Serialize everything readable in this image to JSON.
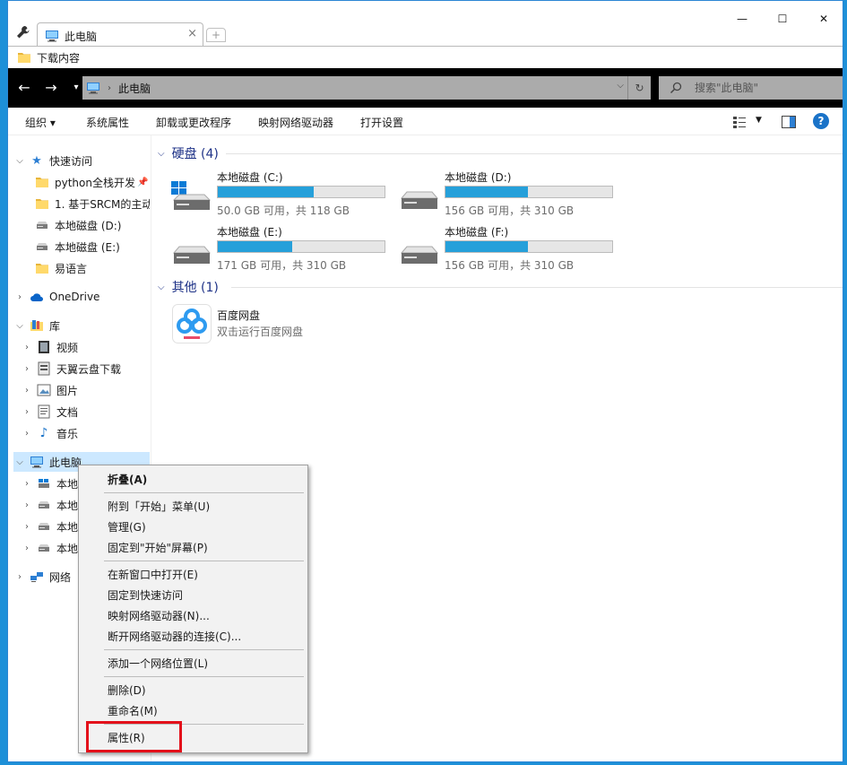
{
  "window": {
    "tab_title": "此电脑",
    "tab_close": "×",
    "new_tab": "+",
    "minimize": "—",
    "maximize": "☐",
    "close": "✕"
  },
  "bookmarks": [
    {
      "label": "下载内容"
    }
  ],
  "address": {
    "path": "此电脑",
    "search_placeholder": "搜索\"此电脑\""
  },
  "toolbar": {
    "organize": "组织",
    "organize_caret": "▾",
    "system_properties": "系统属性",
    "uninstall": "卸载或更改程序",
    "map_drive": "映射网络驱动器",
    "open_settings": "打开设置",
    "help": "?"
  },
  "sidebar": {
    "quick_access": "快速访问",
    "quick_items": [
      {
        "label": "python全栈开发"
      },
      {
        "label": "1. 基于SRCM的主动"
      },
      {
        "label": "本地磁盘 (D:)"
      },
      {
        "label": "本地磁盘 (E:)"
      },
      {
        "label": "易语言"
      }
    ],
    "onedrive": "OneDrive",
    "library": "库",
    "library_items": [
      {
        "label": "视频"
      },
      {
        "label": "天翼云盘下载"
      },
      {
        "label": "图片"
      },
      {
        "label": "文档"
      },
      {
        "label": "音乐"
      }
    ],
    "this_pc": "此电脑",
    "pc_items": [
      {
        "label": "本地"
      },
      {
        "label": "本地"
      },
      {
        "label": "本地"
      },
      {
        "label": "本地"
      }
    ],
    "network": "网络"
  },
  "content": {
    "drives_header": "硬盘 (4)",
    "drives": [
      {
        "name": "本地磁盘 (C:)",
        "info": "50.0 GB 可用，共 118 GB",
        "used_fraction": 0.576
      },
      {
        "name": "本地磁盘 (D:)",
        "info": "156 GB 可用，共 310 GB",
        "used_fraction": 0.497
      },
      {
        "name": "本地磁盘 (E:)",
        "info": "171 GB 可用，共 310 GB",
        "used_fraction": 0.448
      },
      {
        "name": "本地磁盘 (F:)",
        "info": "156 GB 可用，共 310 GB",
        "used_fraction": 0.497
      }
    ],
    "other_header": "其他 (1)",
    "apps": [
      {
        "name": "百度网盘",
        "desc": "双击运行百度网盘"
      }
    ]
  },
  "context_menu": {
    "items": [
      {
        "label": "折叠(A)"
      },
      {
        "label": "附到「开始」菜单(U)"
      },
      {
        "label": "管理(G)"
      },
      {
        "label": "固定到\"开始\"屏幕(P)"
      },
      {
        "label": "在新窗口中打开(E)"
      },
      {
        "label": "固定到快速访问"
      },
      {
        "label": "映射网络驱动器(N)..."
      },
      {
        "label": "断开网络驱动器的连接(C)..."
      },
      {
        "label": "添加一个网络位置(L)"
      },
      {
        "label": "删除(D)"
      },
      {
        "label": "重命名(M)"
      },
      {
        "label": "属性(R)"
      }
    ]
  },
  "colors": {
    "accent": "#26a0da",
    "group_header": "#1e3287",
    "highlight_box": "#e3101a",
    "selection": "#cce8ff"
  }
}
